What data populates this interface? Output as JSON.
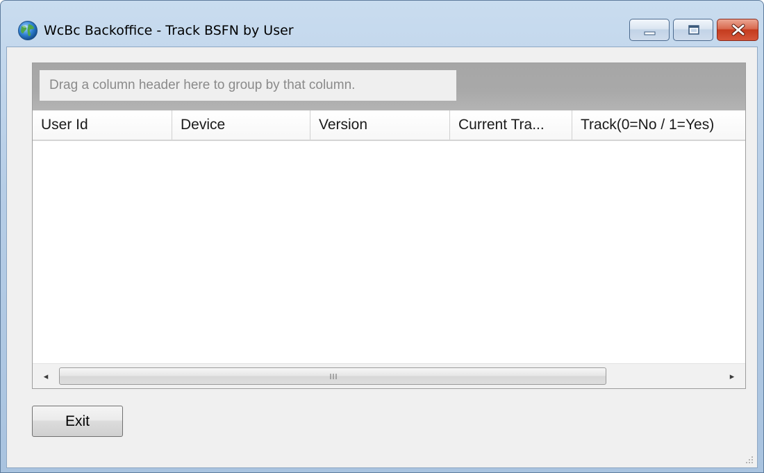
{
  "window": {
    "title": "WcBc Backoffice - Track BSFN by User",
    "icon": "globe-icon"
  },
  "caption_buttons": {
    "minimize_icon": "minimize-icon",
    "maximize_icon": "maximize-icon",
    "close_icon": "close-icon"
  },
  "grid": {
    "group_hint": "Drag a column header here to group by that column.",
    "columns": [
      {
        "label": "User Id"
      },
      {
        "label": "Device"
      },
      {
        "label": "Version"
      },
      {
        "label": "Current Tra..."
      },
      {
        "label": "Track(0=No / 1=Yes)"
      }
    ],
    "rows": [],
    "scrollbar": {
      "left_arrow": "◂",
      "right_arrow": "▸"
    }
  },
  "actions": {
    "exit_label": "Exit"
  },
  "colors": {
    "title_bar": "#b6cde6",
    "close_button": "#c43b1e",
    "client_background": "#f0f0f0",
    "group_panel": "#a9a9a9"
  }
}
